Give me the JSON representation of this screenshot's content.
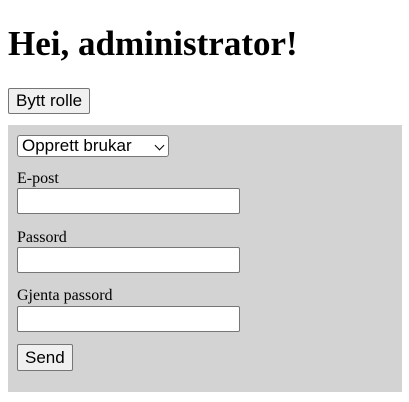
{
  "header": {
    "title": "Hei, administrator!",
    "switch_role_label": "Bytt rolle"
  },
  "form": {
    "action_select": {
      "selected": "Opprett brukar"
    },
    "fields": {
      "email": {
        "label": "E-post",
        "value": ""
      },
      "password": {
        "label": "Passord",
        "value": ""
      },
      "repeat_password": {
        "label": "Gjenta passord",
        "value": ""
      }
    },
    "submit_label": "Send"
  },
  "colors": {
    "panel_background": "#d3d3d3",
    "page_background": "#ffffff"
  }
}
